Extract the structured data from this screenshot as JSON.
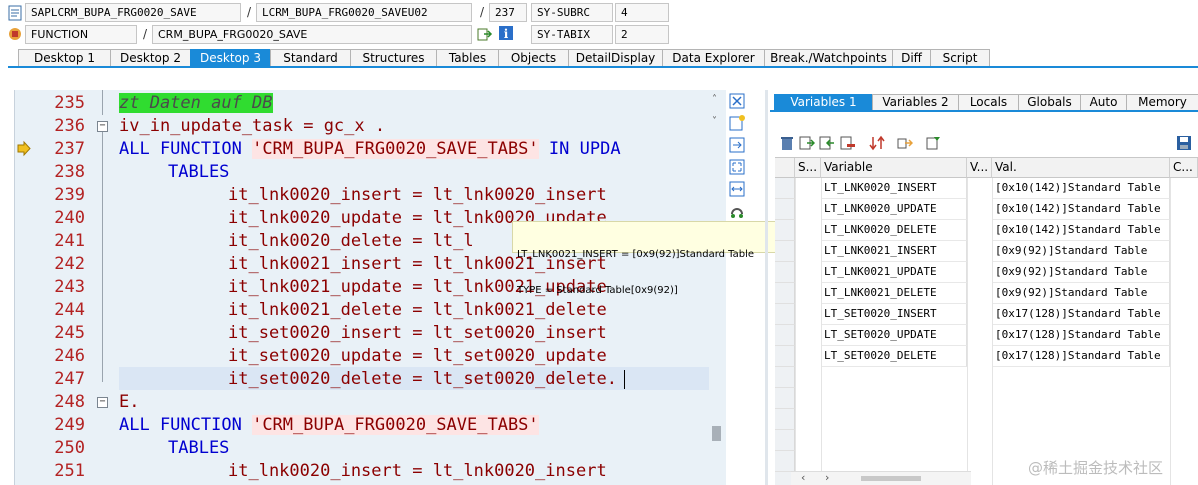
{
  "info": {
    "program": "SAPLCRM_BUPA_FRG0020_SAVE",
    "include": "LCRM_BUPA_FRG0020_SAVEU02",
    "line": "237",
    "subrc_label": "SY-SUBRC",
    "subrc_value": "4",
    "event_type": "FUNCTION",
    "event_name": "CRM_BUPA_FRG0020_SAVE",
    "tabix_label": "SY-TABIX",
    "tabix_value": "2"
  },
  "desktop_tabs": [
    "Desktop 1",
    "Desktop 2",
    "Desktop 3",
    "Standard",
    "Structures",
    "Tables",
    "Objects",
    "DetailDisplay",
    "Data Explorer",
    "Break./Watchpoints",
    "Diff",
    "Script"
  ],
  "active_desktop_tab": "Desktop 3",
  "editor": {
    "lines": [
      {
        "num": "235"
      },
      {
        "num": "236"
      },
      {
        "num": "237"
      },
      {
        "num": "238"
      },
      {
        "num": "239"
      },
      {
        "num": "240"
      },
      {
        "num": "241"
      },
      {
        "num": "242"
      },
      {
        "num": "243"
      },
      {
        "num": "244"
      },
      {
        "num": "245"
      },
      {
        "num": "246"
      },
      {
        "num": "247"
      },
      {
        "num": "248"
      },
      {
        "num": "249"
      },
      {
        "num": "250"
      },
      {
        "num": "251"
      }
    ],
    "code": {
      "l235": "zt Daten auf DB",
      "l236": "iv_in_update_task = gc_x .",
      "l237_kw1": "ALL FUNCTION",
      "l237_str": "'CRM_BUPA_FRG0020_SAVE_TABS'",
      "l237_kw2": "IN UPDA",
      "l238": "TABLES",
      "l239": "it_lnk0020_insert = lt_lnk0020_insert",
      "l240": "it_lnk0020_update = lt_lnk0020_update",
      "l241": "it_lnk0020_delete = lt_l",
      "l242": "it_lnk0021_insert = lt_lnk0021_insert",
      "l243": "it_lnk0021_update = lt_lnk0021_update",
      "l244": "it_lnk0021_delete = lt_lnk0021_delete",
      "l245": "it_set0020_insert = lt_set0020_insert",
      "l246": "it_set0020_update = lt_set0020_update",
      "l247": "it_set0020_delete = lt_set0020_delete.",
      "l248": "E.",
      "l249_kw": "ALL FUNCTION",
      "l249_str": "'CRM_BUPA_FRG0020_SAVE_TABS'",
      "l250": "TABLES",
      "l251": "it_lnk0020_insert = lt_lnk0020_insert"
    },
    "tooltip_line1": "LT_LNK0021_INSERT = [0x9(92)]Standard Table",
    "tooltip_line2": "TYPE = Standard Table[0x9(92)]"
  },
  "variables_tabs": [
    "Variables 1",
    "Variables 2",
    "Locals",
    "Globals",
    "Auto",
    "Memory"
  ],
  "active_variables_tab": "Variables 1",
  "grid": {
    "headers": {
      "s": "S...",
      "variable": "Variable",
      "v": "V...",
      "val": "Val.",
      "c": "C..."
    },
    "rows": [
      {
        "name": "LT_LNK0020_INSERT",
        "val": "[0x10(142)]Standard Table"
      },
      {
        "name": "LT_LNK0020_UPDATE",
        "val": "[0x10(142)]Standard Table"
      },
      {
        "name": "LT_LNK0020_DELETE",
        "val": "[0x10(142)]Standard Table"
      },
      {
        "name": "LT_LNK0021_INSERT",
        "val": "[0x9(92)]Standard Table"
      },
      {
        "name": "LT_LNK0021_UPDATE",
        "val": "[0x9(92)]Standard Table"
      },
      {
        "name": "LT_LNK0021_DELETE",
        "val": "[0x9(92)]Standard Table"
      },
      {
        "name": "LT_SET0020_INSERT",
        "val": "[0x17(128)]Standard Table"
      },
      {
        "name": "LT_SET0020_UPDATE",
        "val": "[0x17(128)]Standard Table"
      },
      {
        "name": "LT_SET0020_DELETE",
        "val": "[0x17(128)]Standard Table"
      }
    ]
  },
  "watermark": "@稀土掘金技术社区",
  "colors": {
    "accent": "#1a8ad8",
    "line_number": "#b32222",
    "keyword": "#0000d0",
    "comment_bg": "#30dc30"
  }
}
